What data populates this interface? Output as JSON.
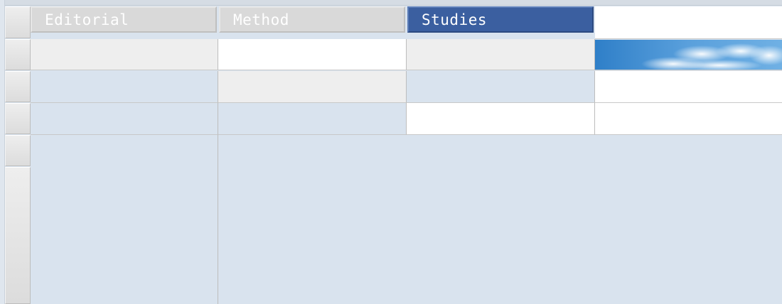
{
  "tabs": [
    {
      "label": "Editorial",
      "active": false
    },
    {
      "label": "Method",
      "active": false
    },
    {
      "label": "Studies",
      "active": true
    }
  ],
  "colors": {
    "active_tab": "#3b5fa0",
    "inactive_tab": "#d9d9d9",
    "panel_blue": "#d9e3ee",
    "cell_gray": "#eeeeee",
    "cell_white": "#ffffff"
  },
  "images": {
    "header_image": "sky-clouds-banner"
  }
}
